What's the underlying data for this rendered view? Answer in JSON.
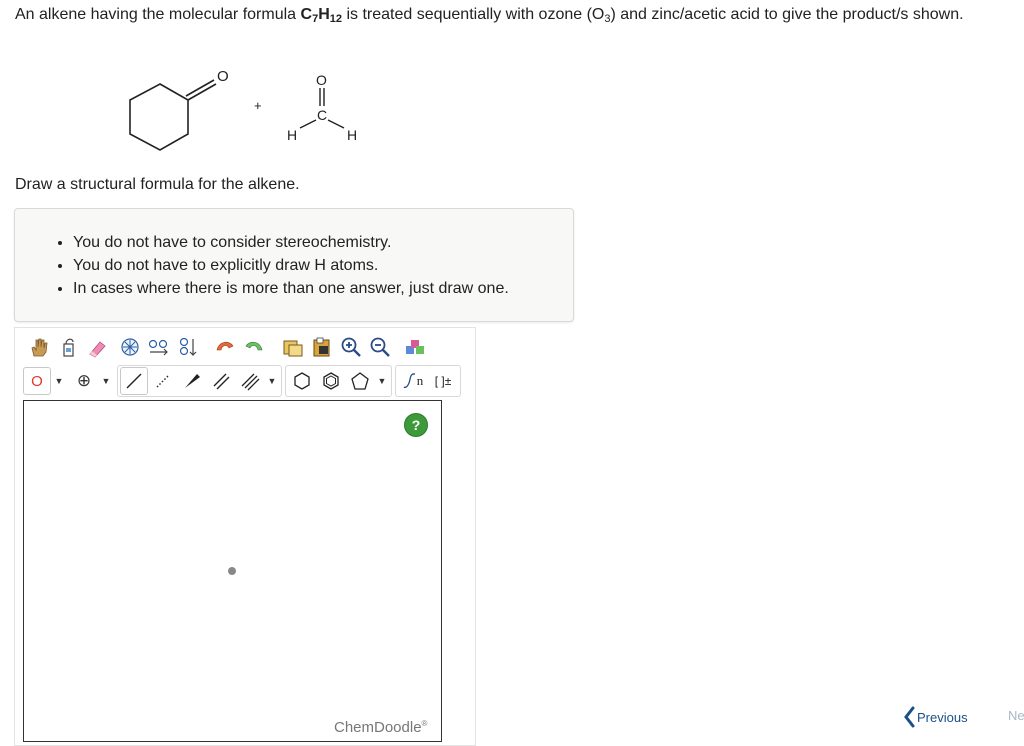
{
  "question": {
    "text_before": "An alkene having the molecular formula ",
    "formula_c": "C",
    "formula_c_sub": "7",
    "formula_h": "H",
    "formula_h_sub": "12",
    "text_middle": " is treated sequentially with ozone (O",
    "ozone_sub": "3",
    "text_after": ") and zinc/acetic acid to give the product/s shown."
  },
  "reaction": {
    "plus": "+",
    "ketone_o": "O",
    "aldehyde_o": "O",
    "aldehyde_c": "C",
    "aldehyde_h_left": "H",
    "aldehyde_h_right": "H"
  },
  "instruction": "Draw a structural formula for the alkene.",
  "hints": [
    "You do not have to consider stereochemistry.",
    "You do not have to explicitly draw H atoms.",
    "In cases where there is more than one answer, just draw one."
  ],
  "editor": {
    "atom_label": "O",
    "charge_label": "⊕",
    "help_label": "?",
    "brand": "ChemDoodle",
    "brand_mark": "®",
    "sgroup_label": "n",
    "bracket_label": "[ ]±"
  },
  "colors": {
    "accent_green": "#3d9a3a",
    "link_blue": "#1a4f8a",
    "atom_red": "#e0382b"
  },
  "nav": {
    "previous": "Previous",
    "next": "Ne"
  }
}
